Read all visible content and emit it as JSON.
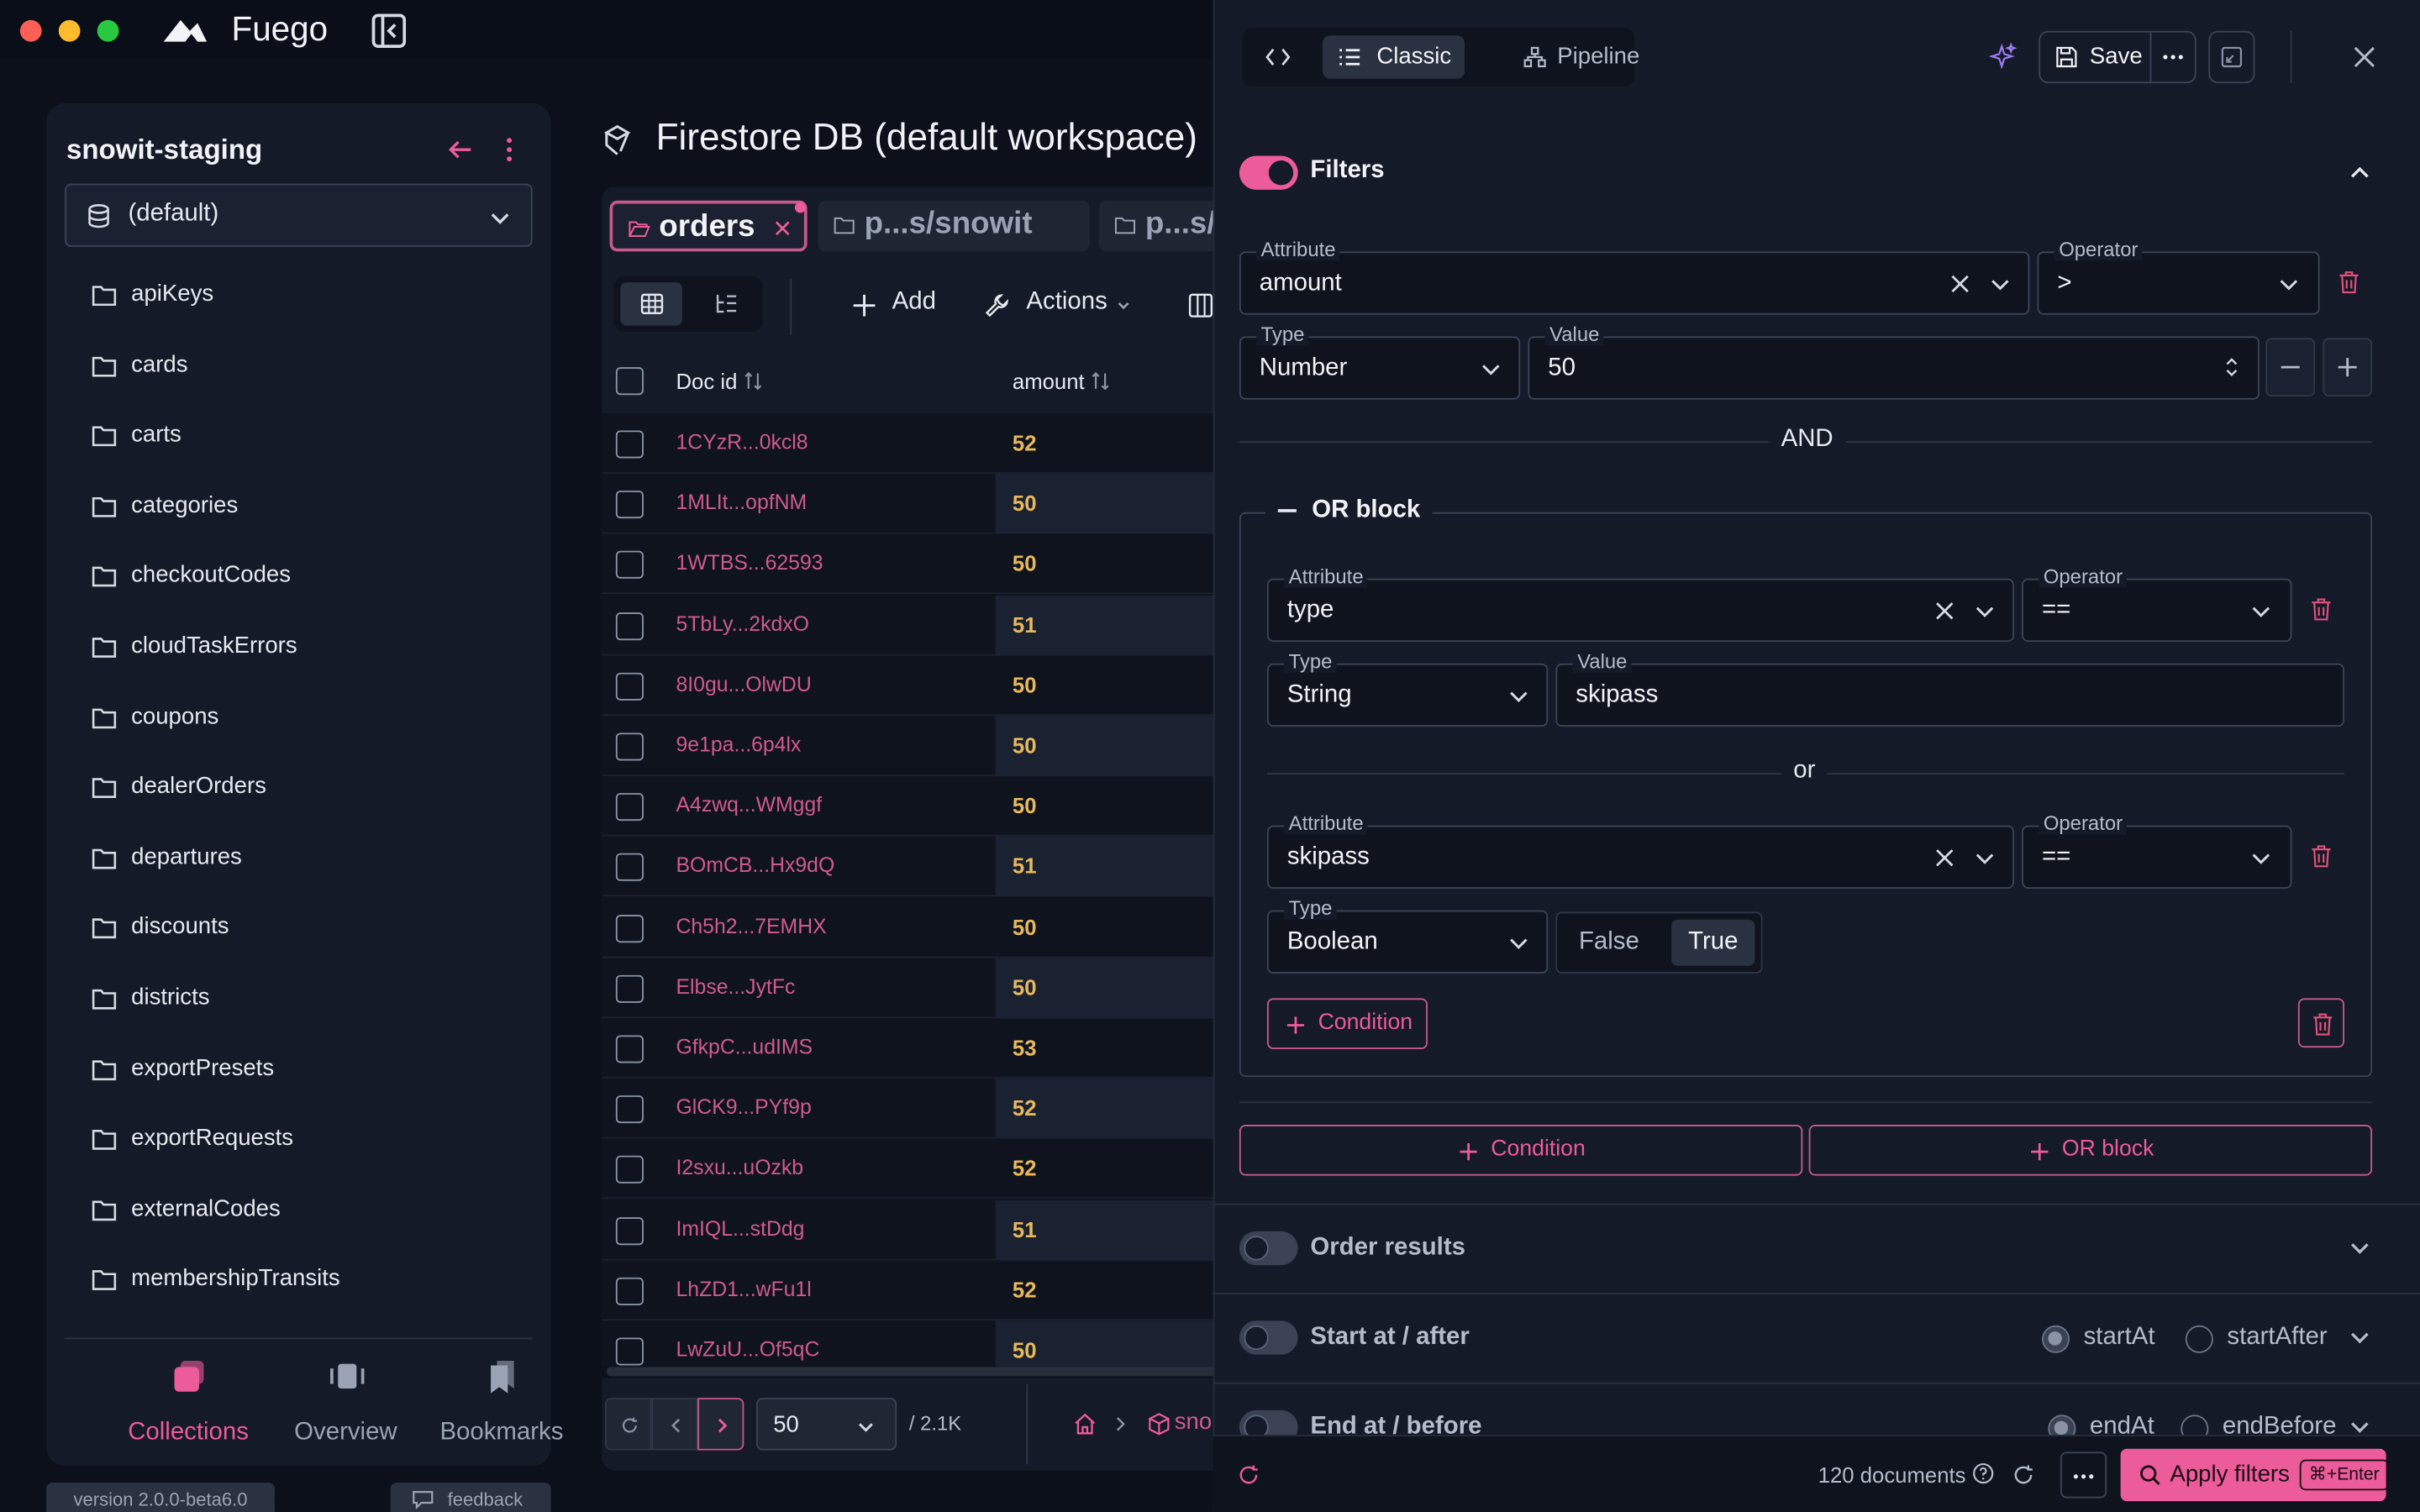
{
  "app": {
    "name": "Fuego"
  },
  "sidebar": {
    "project": "snowit-staging",
    "database": "(default)",
    "collections": [
      "apiKeys",
      "cards",
      "carts",
      "categories",
      "checkoutCodes",
      "cloudTaskErrors",
      "coupons",
      "dealerOrders",
      "departures",
      "discounts",
      "districts",
      "exportPresets",
      "exportRequests",
      "externalCodes",
      "membershipTransits"
    ],
    "nav": {
      "collections": "Collections",
      "overview": "Overview",
      "bookmarks": "Bookmarks"
    },
    "version": "version 2.0.0-beta6.0",
    "feedback": "feedback"
  },
  "main": {
    "title": "Firestore DB (default workspace)",
    "tabs": [
      "orders",
      "p...s/snowit",
      "p...s/"
    ],
    "toolbar": {
      "add": "Add",
      "actions": "Actions"
    },
    "table": {
      "columns": [
        "Doc id",
        "amount"
      ],
      "rows": [
        {
          "id": "1CYzR...0kcl8",
          "amount": "52"
        },
        {
          "id": "1MLIt...opfNM",
          "amount": "50"
        },
        {
          "id": "1WTBS...62593",
          "amount": "50"
        },
        {
          "id": "5TbLy...2kdxO",
          "amount": "51"
        },
        {
          "id": "8I0gu...OlwDU",
          "amount": "50"
        },
        {
          "id": "9e1pa...6p4lx",
          "amount": "50"
        },
        {
          "id": "A4zwq...WMggf",
          "amount": "50"
        },
        {
          "id": "BOmCB...Hx9dQ",
          "amount": "51"
        },
        {
          "id": "Ch5h2...7EMHX",
          "amount": "50"
        },
        {
          "id": "Elbse...JytFc",
          "amount": "50"
        },
        {
          "id": "GfkpC...udIMS",
          "amount": "53"
        },
        {
          "id": "GlCK9...PYf9p",
          "amount": "52"
        },
        {
          "id": "I2sxu...uOzkb",
          "amount": "52"
        },
        {
          "id": "ImIQL...stDdg",
          "amount": "51"
        },
        {
          "id": "LhZD1...wFu1l",
          "amount": "52"
        },
        {
          "id": "LwZuU...Of5qC",
          "amount": "50"
        }
      ]
    },
    "pager": {
      "page_size": "50",
      "total": "/ 2.1K",
      "crumb": "sno"
    }
  },
  "panel": {
    "modes": {
      "classic": "Classic",
      "pipeline": "Pipeline"
    },
    "save": "Save",
    "filters": {
      "title": "Filters",
      "cond1": {
        "attr_label": "Attribute",
        "attr": "amount",
        "op_label": "Operator",
        "op": ">",
        "type_label": "Type",
        "type": "Number",
        "value_label": "Value",
        "value": "50"
      },
      "and": "AND",
      "or_block": {
        "title": "OR block",
        "cond1": {
          "attr_label": "Attribute",
          "attr": "type",
          "op_label": "Operator",
          "op": "==",
          "type_label": "Type",
          "type": "String",
          "value_label": "Value",
          "value": "skipass"
        },
        "or": "or",
        "cond2": {
          "attr_label": "Attribute",
          "attr": "skipass",
          "op_label": "Operator",
          "op": "==",
          "type_label": "Type",
          "type": "Boolean",
          "false": "False",
          "true": "True"
        },
        "add_condition": "Condition"
      },
      "add_condition": "Condition",
      "add_or_block": "OR block"
    },
    "order": {
      "title": "Order results"
    },
    "start": {
      "title": "Start at / after",
      "opt1": "startAt",
      "opt2": "startAfter"
    },
    "end": {
      "title": "End at / before",
      "opt1": "endAt",
      "opt2": "endBefore"
    },
    "footer": {
      "count": "120 documents",
      "apply": "Apply filters",
      "shortcut": "⌘+Enter"
    }
  }
}
